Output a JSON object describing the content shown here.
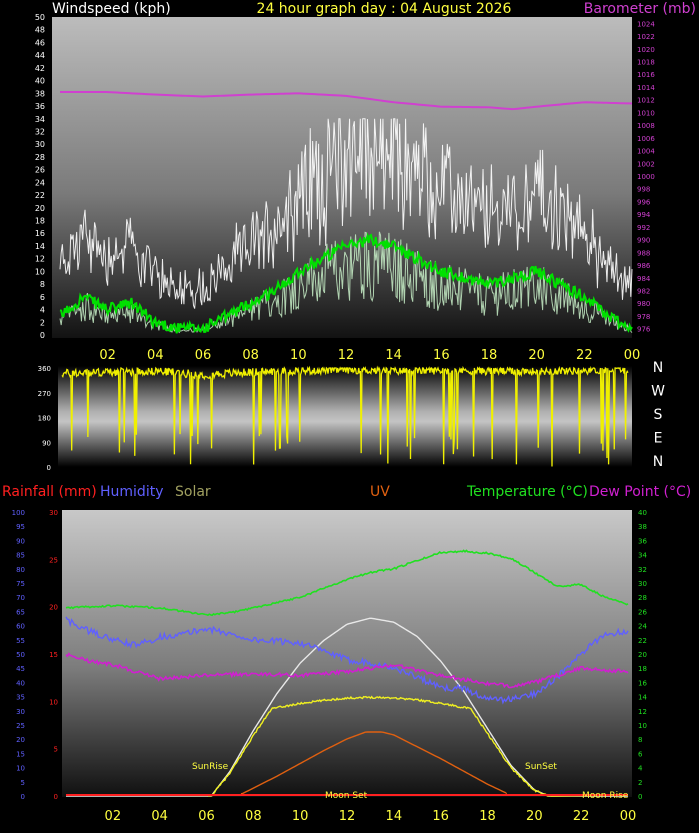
{
  "header": {
    "left": "Windspeed (kph)",
    "center": "24 hour graph day : 04 August 2026",
    "right": "Barometer (mb)"
  },
  "colors": {
    "wind_gust": "#ffffff",
    "wind_raw": "#c8f0c8",
    "wind_avg": "#00e000",
    "barometer": "#d040d0",
    "direction": "#f0f000",
    "rain": "#ff2020",
    "humidity": "#6060ff",
    "solar": "#e8e8e8",
    "uv": "#e06010",
    "temperature": "#20e020",
    "dew_point": "#d020d0",
    "tick_yellow": "#ffff40"
  },
  "x_ticks": [
    "02",
    "04",
    "06",
    "08",
    "10",
    "12",
    "14",
    "16",
    "18",
    "20",
    "22",
    "00"
  ],
  "wind": {
    "y_ticks": [
      0,
      2,
      4,
      6,
      8,
      10,
      12,
      14,
      16,
      18,
      20,
      22,
      24,
      26,
      28,
      30,
      32,
      34,
      36,
      38,
      40,
      42,
      44,
      46,
      48,
      50
    ],
    "ylim": [
      0,
      50
    ]
  },
  "barometer": {
    "y_ticks": [
      976,
      978,
      980,
      982,
      984,
      986,
      988,
      990,
      992,
      994,
      996,
      998,
      1000,
      1002,
      1004,
      1006,
      1008,
      1010,
      1012,
      1014,
      1016,
      1018,
      1020,
      1022,
      1024
    ],
    "ylim": [
      975,
      1025
    ]
  },
  "direction": {
    "y_ticks": [
      0,
      90,
      180,
      270,
      360
    ],
    "compass": [
      "N",
      "W",
      "S",
      "E",
      "N"
    ]
  },
  "lower_legend": {
    "rainfall": "Rainfall (mm)",
    "humidity": "Humidity",
    "solar": "Solar",
    "uv": "UV",
    "temperature": "Temperature (°C)",
    "dew_point": "Dew Point (°C)"
  },
  "humidity_axis": [
    0,
    5,
    10,
    15,
    20,
    25,
    30,
    35,
    40,
    45,
    50,
    55,
    60,
    65,
    70,
    75,
    80,
    85,
    90,
    95,
    100
  ],
  "rain_axis": [
    0,
    5,
    10,
    15,
    20,
    25,
    30
  ],
  "temp_axis": [
    0,
    2,
    4,
    6,
    8,
    10,
    12,
    14,
    16,
    18,
    20,
    22,
    24,
    26,
    28,
    30,
    32,
    34,
    36,
    38,
    40
  ],
  "annotations": {
    "sunrise": "SunRise",
    "sunset": "SunSet",
    "moon_set": "Moon Set",
    "moon_rise": "Moon Rise"
  },
  "chart_data": [
    {
      "type": "line",
      "title": "24 hour graph day : 04 August 2026",
      "ylabel": "Windspeed (kph)",
      "y2label": "Barometer (mb)",
      "ylim": [
        0,
        50
      ],
      "y2lim": [
        975,
        1025
      ],
      "x_unit": "hour",
      "series": [
        {
          "name": "Windspeed (kph)",
          "x": [
            0,
            1,
            2,
            3,
            4,
            5,
            6,
            7,
            8,
            9,
            10,
            11,
            12,
            13,
            14,
            15,
            16,
            17,
            18,
            19,
            20,
            21,
            22,
            23,
            24
          ],
          "y": [
            3,
            6,
            4,
            5,
            2,
            1,
            1,
            3,
            5,
            7,
            10,
            12,
            14,
            15,
            14,
            12,
            10,
            9,
            8,
            9,
            10,
            8,
            6,
            3,
            1
          ]
        },
        {
          "name": "Barometer (mb)",
          "x": [
            0,
            2,
            4,
            6,
            8,
            10,
            12,
            14,
            16,
            18,
            19,
            20,
            22,
            24
          ],
          "y": [
            1013.2,
            1013.2,
            1012.8,
            1012.5,
            1012.8,
            1013.0,
            1012.6,
            1011.6,
            1010.9,
            1010.8,
            1010.5,
            1010.9,
            1011.6,
            1011.4
          ]
        }
      ]
    },
    {
      "type": "line",
      "ylabel": "Direction",
      "ylim": [
        0,
        360
      ],
      "x_unit": "hour",
      "series": [
        {
          "x": [
            0,
            2,
            4,
            6,
            8,
            10,
            12,
            14,
            16,
            18,
            20,
            22,
            24
          ],
          "y": [
            340,
            345,
            350,
            335,
            345,
            350,
            355,
            350,
            352,
            350,
            348,
            352,
            355
          ]
        }
      ]
    },
    {
      "type": "line",
      "ylabel": "Rainfall (mm)",
      "y2label": "Temperature (°C)",
      "ylim": [
        0,
        30
      ],
      "y2lim": [
        0,
        40
      ],
      "x_unit": "hour",
      "series": [
        {
          "name": "Temperature (°C)",
          "x": [
            0,
            2,
            4,
            6,
            7,
            8,
            10,
            12,
            13,
            14,
            16,
            17,
            18,
            19,
            20,
            21,
            22,
            23,
            24
          ],
          "y": [
            26.5,
            26.8,
            26.5,
            25.5,
            25.8,
            26.5,
            28,
            30.5,
            31.5,
            32,
            34.3,
            34.5,
            34.2,
            33.5,
            31.5,
            29.5,
            29.8,
            28,
            27
          ]
        },
        {
          "name": "Humidity",
          "x": [
            0,
            1,
            2,
            3,
            4,
            5,
            6,
            7,
            8,
            10,
            12,
            13,
            14,
            15,
            16,
            17,
            18,
            19,
            20,
            21,
            22,
            23,
            24
          ],
          "y": [
            62,
            58,
            55,
            53,
            56,
            57,
            59,
            57,
            55,
            54,
            48,
            47,
            45,
            42,
            38,
            38,
            34,
            34,
            36,
            42,
            50,
            57,
            58
          ]
        },
        {
          "name": "Dew Point (°C)",
          "x": [
            0,
            1,
            2,
            4,
            6,
            8,
            10,
            12,
            14,
            16,
            18,
            19,
            20,
            21,
            22,
            24
          ],
          "y": [
            20,
            19,
            18.5,
            16.5,
            17,
            17.2,
            17,
            17.5,
            18.5,
            17,
            15.8,
            15.5,
            16,
            17,
            18,
            17.5
          ]
        },
        {
          "name": "Solar",
          "x": [
            6.2,
            7,
            8,
            9,
            10,
            11,
            12,
            13,
            14,
            15,
            16,
            17,
            18,
            19,
            20,
            20.6
          ],
          "y": [
            0,
            120,
            320,
            500,
            650,
            760,
            840,
            870,
            850,
            780,
            660,
            510,
            330,
            150,
            30,
            0
          ]
        },
        {
          "name": "UV",
          "x": [
            7.5,
            8,
            9,
            10,
            11,
            12,
            12.8,
            13.5,
            14,
            15,
            16,
            17,
            18,
            18.8
          ],
          "y": [
            0.2,
            0.8,
            2,
            3.3,
            4.6,
            5.8,
            6.5,
            6.5,
            6.2,
            5,
            3.8,
            2.5,
            1.2,
            0.3
          ]
        },
        {
          "name": "Rainfall (mm)",
          "x": [
            0,
            24
          ],
          "y": [
            0,
            0
          ]
        }
      ]
    }
  ]
}
